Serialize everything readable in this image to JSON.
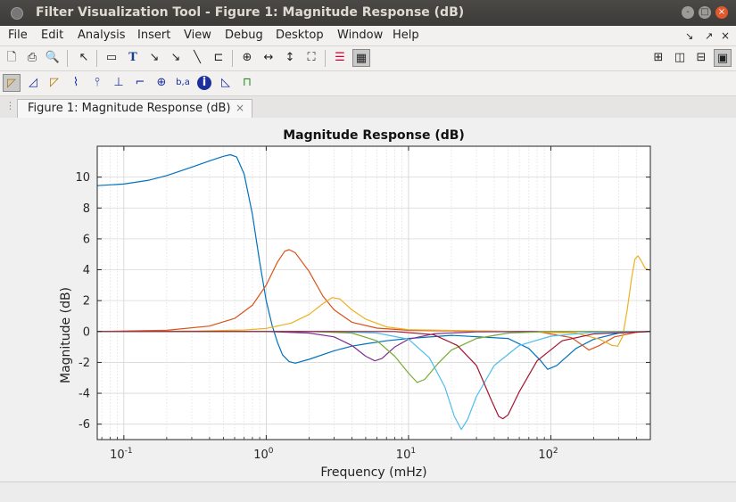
{
  "window": {
    "title": "Filter Visualization Tool - Figure 1: Magnitude Response (dB)",
    "controls": [
      "-",
      "□",
      "×"
    ]
  },
  "menubar": {
    "items": [
      "File",
      "Edit",
      "Analysis",
      "Insert",
      "View",
      "Debug",
      "Desktop",
      "Window",
      "Help"
    ],
    "right_glyphs": [
      "↘",
      "↗",
      "×"
    ]
  },
  "toolbar1": {
    "icons": [
      "new-file-icon",
      "print-icon",
      "print-preview-icon",
      "pointer-icon",
      "rectangle-icon",
      "text-icon",
      "arrow-icon",
      "double-arrow-icon",
      "line-icon",
      "pin-icon",
      "zoom-in-icon",
      "zoom-x-icon",
      "zoom-y-icon",
      "full-view-icon",
      "legend-icon",
      "grid-icon",
      "tile-icon",
      "left-right-icon",
      "top-bottom-icon",
      "single-view-icon"
    ],
    "glyphs": [
      "🗋",
      "⎙",
      "🔍",
      "↖",
      "▭",
      "T",
      "↘",
      "↘",
      "╲",
      "⊏",
      "⊕",
      "↔",
      "↕",
      "⛶",
      "☰",
      "▦",
      "⊞",
      "◫",
      "⊟",
      "▣"
    ]
  },
  "toolbar2": {
    "icons": [
      "magnitude-icon",
      "phase-icon",
      "mag-phase-icon",
      "group-delay-icon",
      "phase-delay-icon",
      "impulse-icon",
      "step-icon",
      "pole-zero-icon",
      "coefficients-icon",
      "info-icon",
      "magnitude-estimate-icon",
      "round-off-icon"
    ],
    "glyphs": [
      "◸",
      "◿",
      "◸",
      "⌇",
      "⫯",
      "⊥",
      "⌐",
      "⊕",
      "b,a",
      "i",
      "◺",
      "⊓"
    ]
  },
  "tab": {
    "label": "Figure 1: Magnitude Response (dB)",
    "close": "×"
  },
  "chart_data": {
    "type": "line",
    "title": "Magnitude Response (dB)",
    "xlabel": "Frequency (mHz)",
    "ylabel": "Magnitude (dB)",
    "xscale": "log",
    "xlim": [
      0.065,
      500
    ],
    "ylim": [
      -7,
      12
    ],
    "yticks": [
      -6,
      -4,
      -2,
      0,
      2,
      4,
      6,
      8,
      10
    ],
    "ytick_labels": [
      "-6",
      "-4",
      "-2",
      "0",
      "2",
      "4",
      "6",
      "8",
      "10"
    ],
    "xtick_labels": [
      {
        "base": "10",
        "exp": "-1",
        "value": 0.1
      },
      {
        "base": "10",
        "exp": "0",
        "value": 1
      },
      {
        "base": "10",
        "exp": "1",
        "value": 10
      },
      {
        "base": "10",
        "exp": "2",
        "value": 100
      }
    ],
    "grid": true,
    "series": [
      {
        "color": "#0072bd",
        "points": [
          [
            0.065,
            9.45
          ],
          [
            0.1,
            9.55
          ],
          [
            0.15,
            9.8
          ],
          [
            0.2,
            10.1
          ],
          [
            0.3,
            10.65
          ],
          [
            0.4,
            11.05
          ],
          [
            0.5,
            11.35
          ],
          [
            0.56,
            11.45
          ],
          [
            0.62,
            11.3
          ],
          [
            0.7,
            10.2
          ],
          [
            0.8,
            7.6
          ],
          [
            0.9,
            4.5
          ],
          [
            1.0,
            2.0
          ],
          [
            1.1,
            0.4
          ],
          [
            1.2,
            -0.7
          ],
          [
            1.3,
            -1.5
          ],
          [
            1.45,
            -1.95
          ],
          [
            1.6,
            -2.05
          ],
          [
            2.0,
            -1.8
          ],
          [
            3.0,
            -1.25
          ],
          [
            4.0,
            -0.95
          ],
          [
            5.0,
            -0.8
          ],
          [
            7.0,
            -0.6
          ],
          [
            10,
            -0.45
          ],
          [
            20,
            -0.25
          ],
          [
            50,
            -0.45
          ],
          [
            70,
            -1.1
          ],
          [
            85,
            -1.9
          ],
          [
            95,
            -2.45
          ],
          [
            110,
            -2.2
          ],
          [
            150,
            -1.1
          ],
          [
            200,
            -0.5
          ],
          [
            300,
            -0.1
          ],
          [
            500,
            0
          ]
        ]
      },
      {
        "color": "#d95319",
        "points": [
          [
            0.065,
            0
          ],
          [
            0.2,
            0.08
          ],
          [
            0.4,
            0.35
          ],
          [
            0.6,
            0.85
          ],
          [
            0.8,
            1.7
          ],
          [
            1.0,
            3.0
          ],
          [
            1.2,
            4.5
          ],
          [
            1.35,
            5.2
          ],
          [
            1.45,
            5.3
          ],
          [
            1.6,
            5.1
          ],
          [
            2.0,
            3.9
          ],
          [
            2.5,
            2.3
          ],
          [
            3.0,
            1.4
          ],
          [
            4.0,
            0.6
          ],
          [
            6.0,
            0.22
          ],
          [
            10,
            0.08
          ],
          [
            30,
            0.02
          ],
          [
            80,
            0
          ],
          [
            140,
            -0.4
          ],
          [
            170,
            -0.95
          ],
          [
            185,
            -1.2
          ],
          [
            220,
            -0.9
          ],
          [
            280,
            -0.35
          ],
          [
            400,
            -0.05
          ],
          [
            500,
            0
          ]
        ]
      },
      {
        "color": "#edb120",
        "points": [
          [
            0.065,
            0
          ],
          [
            0.3,
            0.02
          ],
          [
            0.7,
            0.1
          ],
          [
            1.0,
            0.2
          ],
          [
            1.5,
            0.55
          ],
          [
            2.0,
            1.1
          ],
          [
            2.5,
            1.8
          ],
          [
            2.9,
            2.2
          ],
          [
            3.3,
            2.1
          ],
          [
            4.0,
            1.4
          ],
          [
            5.0,
            0.8
          ],
          [
            7.0,
            0.3
          ],
          [
            10,
            0.12
          ],
          [
            40,
            0.02
          ],
          [
            150,
            -0.1
          ],
          [
            220,
            -0.5
          ],
          [
            270,
            -0.9
          ],
          [
            295,
            -0.95
          ],
          [
            320,
            -0.3
          ],
          [
            345,
            1.5
          ],
          [
            370,
            3.5
          ],
          [
            390,
            4.7
          ],
          [
            410,
            4.9
          ],
          [
            430,
            4.6
          ],
          [
            460,
            4.1
          ],
          [
            500,
            3.95
          ]
        ]
      },
      {
        "color": "#7e2f8e",
        "points": [
          [
            0.065,
            0
          ],
          [
            1.0,
            0
          ],
          [
            2.0,
            -0.1
          ],
          [
            3.0,
            -0.35
          ],
          [
            4.0,
            -0.9
          ],
          [
            5.0,
            -1.6
          ],
          [
            5.8,
            -1.9
          ],
          [
            6.5,
            -1.75
          ],
          [
            8.0,
            -1.0
          ],
          [
            10,
            -0.5
          ],
          [
            15,
            -0.15
          ],
          [
            30,
            -0.02
          ],
          [
            100,
            0
          ],
          [
            500,
            0
          ]
        ]
      },
      {
        "color": "#77ac30",
        "points": [
          [
            0.065,
            0
          ],
          [
            2.0,
            0
          ],
          [
            4.0,
            -0.1
          ],
          [
            6.0,
            -0.6
          ],
          [
            8.0,
            -1.6
          ],
          [
            10,
            -2.7
          ],
          [
            11.5,
            -3.3
          ],
          [
            13,
            -3.1
          ],
          [
            16,
            -2.1
          ],
          [
            20,
            -1.2
          ],
          [
            30,
            -0.45
          ],
          [
            50,
            -0.1
          ],
          [
            100,
            0
          ],
          [
            500,
            0
          ]
        ]
      },
      {
        "color": "#4dbeee",
        "points": [
          [
            0.065,
            0
          ],
          [
            3.0,
            0
          ],
          [
            6.0,
            -0.1
          ],
          [
            10,
            -0.5
          ],
          [
            14,
            -1.7
          ],
          [
            18,
            -3.6
          ],
          [
            21,
            -5.5
          ],
          [
            23.5,
            -6.35
          ],
          [
            26,
            -5.7
          ],
          [
            30,
            -4.2
          ],
          [
            40,
            -2.2
          ],
          [
            60,
            -0.9
          ],
          [
            100,
            -0.3
          ],
          [
            200,
            -0.05
          ],
          [
            500,
            0
          ]
        ]
      },
      {
        "color": "#a2142f",
        "points": [
          [
            0.065,
            0
          ],
          [
            8.0,
            0
          ],
          [
            15,
            -0.2
          ],
          [
            22,
            -0.9
          ],
          [
            30,
            -2.2
          ],
          [
            38,
            -4.4
          ],
          [
            43,
            -5.5
          ],
          [
            46,
            -5.65
          ],
          [
            50,
            -5.4
          ],
          [
            60,
            -3.9
          ],
          [
            80,
            -1.9
          ],
          [
            120,
            -0.6
          ],
          [
            200,
            -0.15
          ],
          [
            500,
            0
          ]
        ]
      }
    ]
  }
}
